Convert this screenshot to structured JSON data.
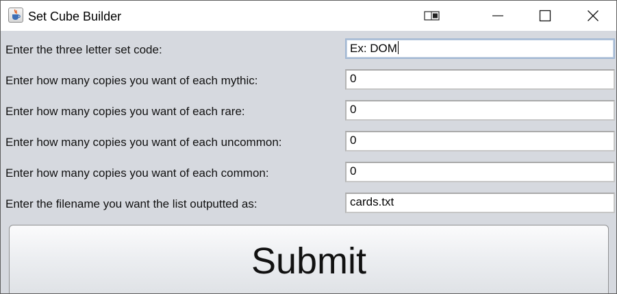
{
  "window": {
    "title": "Set Cube Builder",
    "icon": "java-cup-icon"
  },
  "titlebar_buttons": {
    "snap": "snap-layout-icon",
    "minimize": "minimize-icon",
    "maximize": "maximize-icon",
    "close": "close-icon"
  },
  "form": {
    "rows": [
      {
        "label": "Enter the three letter set code:",
        "value": "Ex: DOM",
        "focused": true
      },
      {
        "label": "Enter how many copies you want of each mythic:",
        "value": "0"
      },
      {
        "label": "Enter how many copies you want of each rare:",
        "value": "0"
      },
      {
        "label": "Enter how many copies you want of each uncommon:",
        "value": "0"
      },
      {
        "label": "Enter how many copies you want of each common:",
        "value": "0"
      },
      {
        "label": "Enter the filename you want the list outputted as:",
        "value": "cards.txt"
      }
    ]
  },
  "submit_label": "Submit",
  "colors": {
    "background": "#d6d9df",
    "focus_border": "#a3b8d3"
  }
}
